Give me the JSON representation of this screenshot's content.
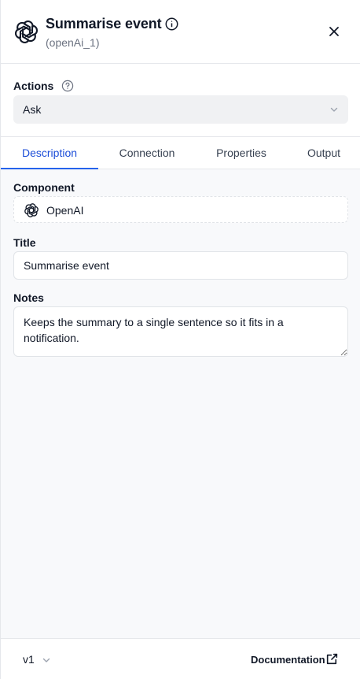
{
  "header": {
    "title": "Summarise event",
    "subtitle": "(openAi_1)",
    "icons": {
      "logo": "openai-logo-icon",
      "info": "info-icon",
      "close": "close-icon"
    }
  },
  "actions": {
    "label": "Actions",
    "help_icon": "help-circle-icon",
    "selected": "Ask"
  },
  "tabs": [
    {
      "label": "Description",
      "active": true
    },
    {
      "label": "Connection",
      "active": false
    },
    {
      "label": "Properties",
      "active": false
    },
    {
      "label": "Output",
      "active": false
    }
  ],
  "form": {
    "component": {
      "label": "Component",
      "value": "OpenAI",
      "icon": "openai-logo-icon"
    },
    "title": {
      "label": "Title",
      "value": "Summarise event"
    },
    "notes": {
      "label": "Notes",
      "value": "Keeps the summary to a single sentence so it fits in a notification."
    }
  },
  "footer": {
    "version": "v1",
    "documentation": "Documentation",
    "external_icon": "external-link-icon"
  },
  "colors": {
    "accent": "#2563eb",
    "background": "#f8f9fb",
    "border": "#e5e7eb"
  }
}
